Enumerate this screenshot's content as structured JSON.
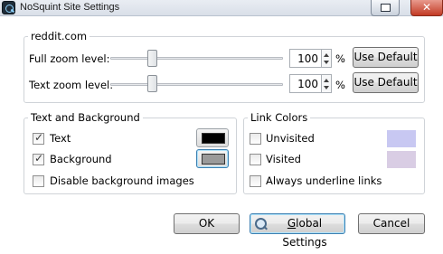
{
  "window": {
    "title": "NoSquint Site Settings",
    "close_glyph": "✕"
  },
  "site": {
    "domain": "reddit.com",
    "full_zoom": {
      "label": "Full zoom level:",
      "value": "100",
      "unit": "%",
      "slider_level": 0.29,
      "default_button": "Use Default"
    },
    "text_zoom": {
      "label": "Text zoom level:",
      "value": "100",
      "unit": "%",
      "slider_level": 0.29,
      "default_button": "Use Default"
    }
  },
  "text_bg": {
    "legend": "Text and Background",
    "text": {
      "label": "Text",
      "checked": true,
      "color": "#000000"
    },
    "background": {
      "label": "Background",
      "checked": true,
      "color": "#9a9a9a"
    },
    "disable_images": {
      "label": "Disable background images",
      "checked": false
    }
  },
  "link_colors": {
    "legend": "Link Colors",
    "unvisited": {
      "label": "Unvisited",
      "checked": false,
      "color": "#c8c8f2"
    },
    "visited": {
      "label": "Visited",
      "checked": false,
      "color": "#d9cde4"
    },
    "underline": {
      "label": "Always underline links",
      "checked": false
    }
  },
  "buttons": {
    "ok": "OK",
    "global_prefix": "G",
    "global_rest": "lobal Settings",
    "cancel": "Cancel"
  }
}
